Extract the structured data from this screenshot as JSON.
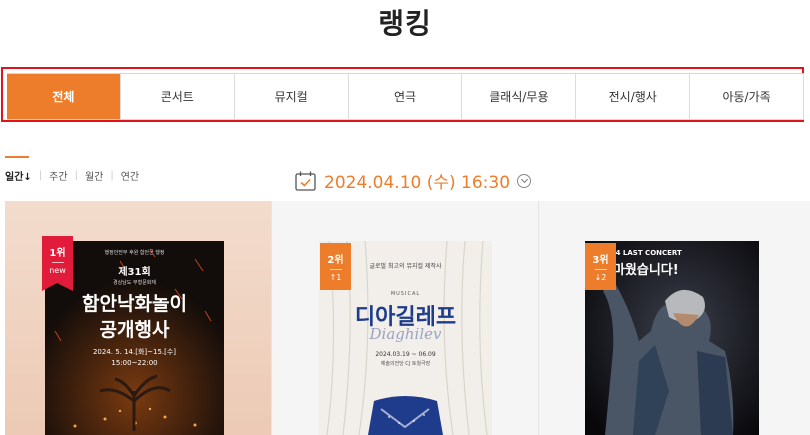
{
  "page_title": "랭킹",
  "tabs": [
    "전체",
    "콘서트",
    "뮤지컬",
    "연극",
    "클래식/무용",
    "전시/행사",
    "아동/가족"
  ],
  "period": {
    "items": [
      "일간↓",
      "주간",
      "월간",
      "연간"
    ]
  },
  "date": {
    "text": "2024.04.10 (수) 16:30"
  },
  "ranks": [
    {
      "rank": "1위",
      "change": "new",
      "poster": {
        "top": "행정안전부 후원 함안군 행정",
        "num": "제31회",
        "sub": "경상남도 무형문화재",
        "title1": "함안낙화놀이",
        "title2": "공개행사",
        "date": "2024. 5. 14.[화]~15.[수]",
        "time": "15:00~22:00"
      }
    },
    {
      "rank": "2위",
      "change": "↑1",
      "poster": {
        "top": "글로벌 최고의 뮤지컬 제작사",
        "label": "MUSICAL",
        "title": "디아길레프",
        "script": "Diaghilev",
        "date": "2024.03.19 ~ 06.09",
        "venue": "예술의전당 CJ 토월극장"
      }
    },
    {
      "rank": "3위",
      "change": "↓2",
      "poster": {
        "top": "2024 LAST CONCERT",
        "title": "고마웠습니다!"
      }
    }
  ]
}
